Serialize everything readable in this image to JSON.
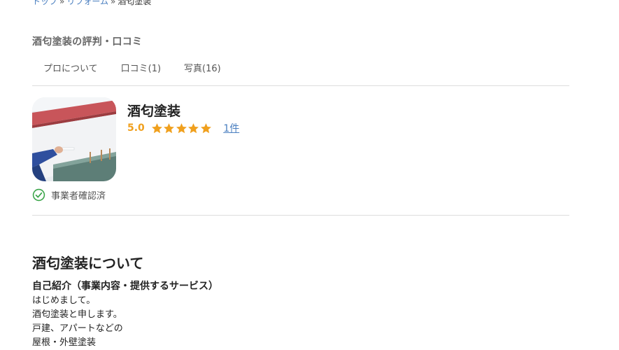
{
  "breadcrumb": {
    "items": [
      "トップ",
      "リフォーム",
      "酒匂塗装"
    ],
    "separator": "»"
  },
  "section_heading": "酒匂塗装の評判・口コミ",
  "tabs": [
    {
      "label": "プロについて"
    },
    {
      "label": "口コミ(1)"
    },
    {
      "label": "写真(16)"
    }
  ],
  "pro": {
    "name": "酒匂塗装",
    "rating": "5.0",
    "stars": 5,
    "review_count": "1件",
    "verified_label": "事業者確認済"
  },
  "about": {
    "title": "酒匂塗装について",
    "intro_subtitle": "自己紹介（事業内容・提供するサービス）",
    "intro_lines": [
      "はじめまして。",
      "酒匂塗装と申します。",
      "戸建、アパートなどの",
      "屋根・外壁塗装"
    ]
  },
  "colors": {
    "accent_star": "#f0a01e",
    "link": "#4a7fc0",
    "verified_green": "#3ba54a",
    "divider": "#dddddd"
  }
}
